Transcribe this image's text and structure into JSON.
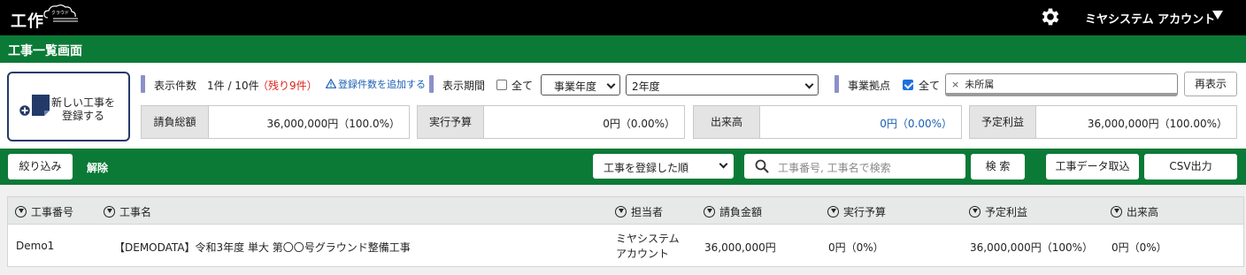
{
  "header": {
    "logo_text": "工作",
    "logo_subtext": "クラウド",
    "account_label": "ミヤシステム アカウント"
  },
  "title": "工事一覧画面",
  "new_button": {
    "line1": "新しい工事を",
    "line2": "登録する"
  },
  "display_count": {
    "label": "表示件数",
    "value": "1件 / 10件",
    "remaining": "（残り9件）",
    "add_link": "登録件数を追加する"
  },
  "period": {
    "label": "表示期間",
    "all_label": "全て",
    "all_checked": false,
    "fiscal_select": "事業年度",
    "year_select": "2年度"
  },
  "base": {
    "label": "事業拠点",
    "all_label": "全て",
    "all_checked": true,
    "tag": "未所属",
    "tag_remove": "×",
    "redisplay_button": "再表示"
  },
  "metrics": [
    {
      "label": "請負総額",
      "value": "36,000,000円（100.0%）",
      "color": "#222222"
    },
    {
      "label": "実行予算",
      "value": "0円（0.00%）",
      "color": "#222222"
    },
    {
      "label": "出来高",
      "value": "0円（0.00%）",
      "color": "#1a5fb4"
    },
    {
      "label": "予定利益",
      "value": "36,000,000円（100.00%）",
      "color": "#222222"
    }
  ],
  "toolbar": {
    "filter_button": "絞り込み",
    "clear_link": "解除",
    "sort_select": "工事を登録した順",
    "search_placeholder": "工事番号, 工事名で検索",
    "search_button": "検 索",
    "import_button": "工事データ取込",
    "csv_button": "CSV出力"
  },
  "table": {
    "columns": [
      "工事番号",
      "工事名",
      "担当者",
      "請負金額",
      "実行予算",
      "予定利益",
      "出来高"
    ],
    "rows": [
      {
        "number": "Demo1",
        "name": "【DEMODATA】令和3年度 単大 第〇〇号グラウンド整備工事",
        "person_line1": "ミヤシステム",
        "person_line2": "アカウント",
        "contract": "36,000,000円",
        "budget": "0円（0%）",
        "profit": "36,000,000円（100%）",
        "progress": "0円（0%）"
      }
    ]
  },
  "colors": {
    "brand_green": "#0b7a36",
    "accent_blue": "#1a5fb4",
    "remaining_red": "#d9241b"
  }
}
